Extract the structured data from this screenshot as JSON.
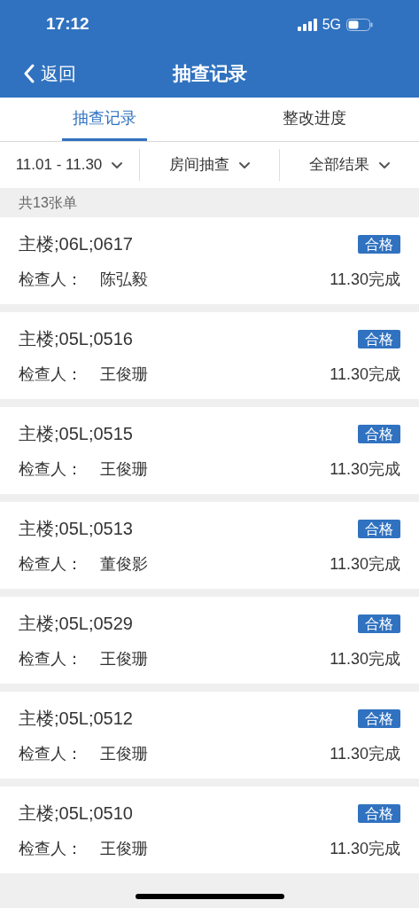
{
  "status_bar": {
    "time": "17:12",
    "network": "5G"
  },
  "nav": {
    "back": "返回",
    "title": "抽查记录"
  },
  "tabs": [
    {
      "label": "抽查记录",
      "selected": true
    },
    {
      "label": "整改进度",
      "selected": false
    }
  ],
  "filters": [
    {
      "label": "11.01 - 11.30"
    },
    {
      "label": "房间抽查"
    },
    {
      "label": "全部结果"
    }
  ],
  "count": "共13张单",
  "records": [
    {
      "room": "主楼;06L;0617",
      "result": "合格",
      "inspector_label": "检查人：",
      "inspector": "陈弘毅",
      "status": "11.30完成"
    },
    {
      "room": "主楼;05L;0516",
      "result": "合格",
      "inspector_label": "检查人：",
      "inspector": "王俊珊",
      "status": "11.30完成"
    },
    {
      "room": "主楼;05L;0515",
      "result": "合格",
      "inspector_label": "检查人：",
      "inspector": "王俊珊",
      "status": "11.30完成"
    },
    {
      "room": "主楼;05L;0513",
      "result": "合格",
      "inspector_label": "检查人：",
      "inspector": "董俊影",
      "status": "11.30完成"
    },
    {
      "room": "主楼;05L;0529",
      "result": "合格",
      "inspector_label": "检查人：",
      "inspector": "王俊珊",
      "status": "11.30完成"
    },
    {
      "room": "主楼;05L;0512",
      "result": "合格",
      "inspector_label": "检查人：",
      "inspector": "王俊珊",
      "status": "11.30完成"
    },
    {
      "room": "主楼;05L;0510",
      "result": "合格",
      "inspector_label": "检查人：",
      "inspector": "王俊珊",
      "status": "11.30完成"
    }
  ]
}
